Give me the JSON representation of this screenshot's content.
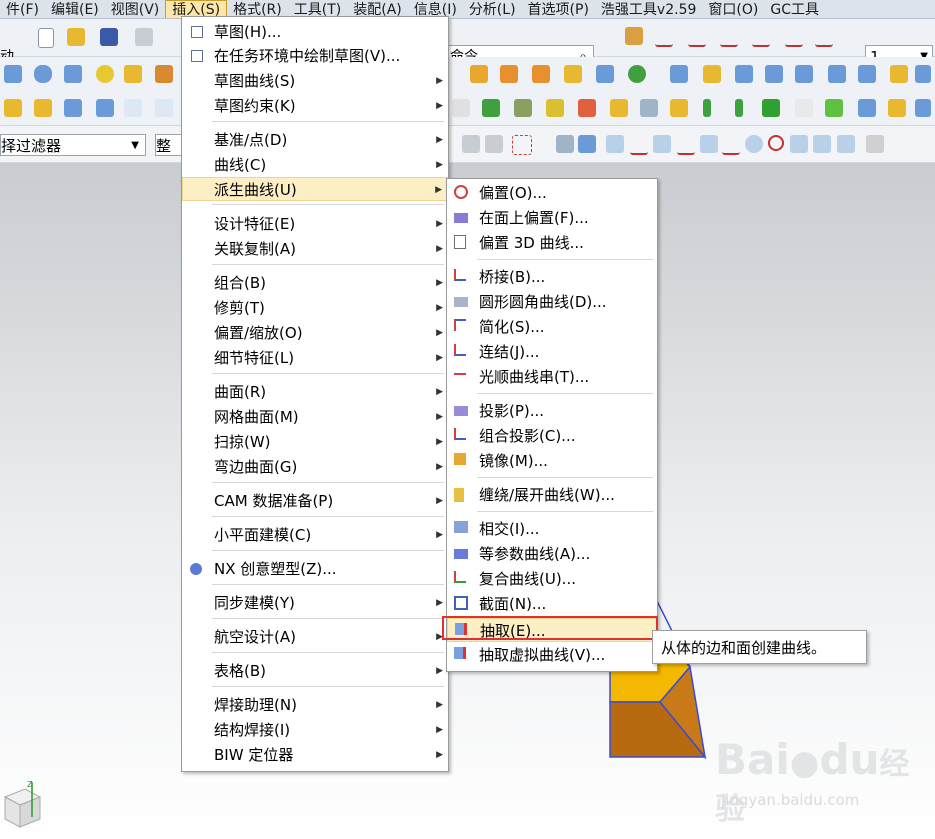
{
  "menubar": [
    "件(F)",
    "编辑(E)",
    "视图(V)",
    "插入(S)",
    "格式(R)",
    "工具(T)",
    "装配(A)",
    "信息(I)",
    "分析(L)",
    "首选项(P)",
    "浩强工具v2.59",
    "窗口(O)",
    "GC工具"
  ],
  "toolbar": {
    "move_label": "动",
    "command_search": "命令",
    "layer_value": "1",
    "filter_label": "择过滤器",
    "filter2_label": "整个"
  },
  "insert_menu": {
    "items": [
      {
        "label": "草图(H)...",
        "sub": false,
        "icon": "sketch-icon"
      },
      {
        "label": "在任务环境中绘制草图(V)...",
        "sub": false,
        "icon": "sketch-task-icon"
      },
      {
        "label": "草图曲线(S)",
        "sub": true
      },
      {
        "label": "草图约束(K)",
        "sub": true
      },
      {
        "label": "基准/点(D)",
        "sub": true
      },
      {
        "label": "曲线(C)",
        "sub": true
      },
      {
        "label": "派生曲线(U)",
        "sub": true,
        "highlight": true
      },
      {
        "label": "设计特征(E)",
        "sub": true
      },
      {
        "label": "关联复制(A)",
        "sub": true
      },
      {
        "label": "组合(B)",
        "sub": true
      },
      {
        "label": "修剪(T)",
        "sub": true
      },
      {
        "label": "偏置/缩放(O)",
        "sub": true
      },
      {
        "label": "细节特征(L)",
        "sub": true
      },
      {
        "label": "曲面(R)",
        "sub": true
      },
      {
        "label": "网格曲面(M)",
        "sub": true
      },
      {
        "label": "扫掠(W)",
        "sub": true
      },
      {
        "label": "弯边曲面(G)",
        "sub": true
      },
      {
        "label": "CAM 数据准备(P)",
        "sub": true
      },
      {
        "label": "小平面建模(C)",
        "sub": true
      },
      {
        "label": "NX 创意塑型(Z)...",
        "sub": false,
        "icon": "nx-realize-shape-icon"
      },
      {
        "label": "同步建模(Y)",
        "sub": true
      },
      {
        "label": "航空设计(A)",
        "sub": true
      },
      {
        "label": "表格(B)",
        "sub": true
      },
      {
        "label": "焊接助理(N)",
        "sub": true
      },
      {
        "label": "结构焊接(I)",
        "sub": true
      },
      {
        "label": "BIW 定位器",
        "sub": true
      }
    ]
  },
  "derived_curve_menu": {
    "items": [
      {
        "label": "偏置(O)...",
        "icon": "offset-curve-icon"
      },
      {
        "label": "在面上偏置(F)...",
        "icon": "offset-on-face-icon"
      },
      {
        "label": "偏置 3D 曲线...",
        "icon": "offset-3d-curve-icon"
      },
      {
        "label": "桥接(B)...",
        "icon": "bridge-curve-icon"
      },
      {
        "label": "圆形圆角曲线(D)...",
        "icon": "circular-fillet-icon"
      },
      {
        "label": "简化(S)...",
        "icon": "simplify-icon"
      },
      {
        "label": "连结(J)...",
        "icon": "join-curve-icon"
      },
      {
        "label": "光顺曲线串(T)...",
        "icon": "smooth-string-icon"
      },
      {
        "label": "投影(P)...",
        "icon": "project-curve-icon"
      },
      {
        "label": "组合投影(C)...",
        "icon": "combined-projection-icon"
      },
      {
        "label": "镜像(M)...",
        "icon": "mirror-curve-icon"
      },
      {
        "label": "缠绕/展开曲线(W)...",
        "icon": "wrap-unwrap-icon"
      },
      {
        "label": "相交(I)...",
        "icon": "intersect-curve-icon"
      },
      {
        "label": "等参数曲线(A)...",
        "icon": "isoparametric-icon"
      },
      {
        "label": "复合曲线(U)...",
        "icon": "composite-curve-icon"
      },
      {
        "label": "截面(N)...",
        "icon": "section-curve-icon"
      },
      {
        "label": "抽取(E)...",
        "icon": "extract-curve-icon",
        "highlight": true
      },
      {
        "label": "抽取虚拟曲线(V)...",
        "icon": "extract-virtual-icon"
      }
    ]
  },
  "tooltip": "从体的边和面创建曲线。",
  "watermark": {
    "brand": "Bai",
    "brand2": "du",
    "cn": "经验",
    "url": "jingyan.baidu.com"
  },
  "colors": {
    "highlight": "#fcefc6",
    "red_box": "#e03030",
    "solid_top": "#f5b800",
    "solid_side": "#b86a10"
  }
}
